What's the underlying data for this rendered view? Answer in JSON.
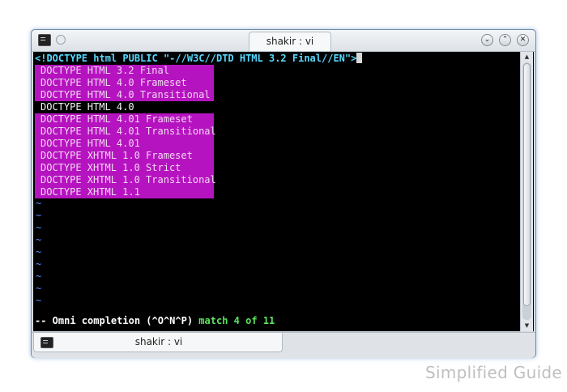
{
  "window": {
    "title": "shakir : vi",
    "buttons": {
      "minimize": "⌄",
      "maximize": "⌃",
      "close": "✕"
    }
  },
  "terminal": {
    "command": "<!DOCTYPE html PUBLIC \"-//W3C//DTD HTML 3.2 Final//EN\">",
    "completion_items": [
      "DOCTYPE HTML 3.2 Final",
      "DOCTYPE HTML 4.0 Frameset",
      "DOCTYPE HTML 4.0 Transitional",
      "DOCTYPE HTML 4.0",
      "DOCTYPE HTML 4.01 Frameset",
      "DOCTYPE HTML 4.01 Transitional",
      "DOCTYPE HTML 4.01",
      "DOCTYPE XHTML 1.0 Frameset",
      "DOCTYPE XHTML 1.0 Strict",
      "DOCTYPE XHTML 1.0 Transitional",
      "DOCTYPE XHTML 1.1"
    ],
    "selected_index": 3,
    "empty_line_marker": "~",
    "status_mode": "-- Omni completion (^O^N^P) ",
    "status_match": "match 4 of 11"
  },
  "tabbar": {
    "tab_label": "shakir : vi"
  },
  "watermark": "Simplified Guide",
  "colors": {
    "popup_bg": "#b613c0",
    "selected_bg": "#000000",
    "command_text": "#58d8ff",
    "tilde": "#5a8cff",
    "match_text": "#5fe25f"
  }
}
